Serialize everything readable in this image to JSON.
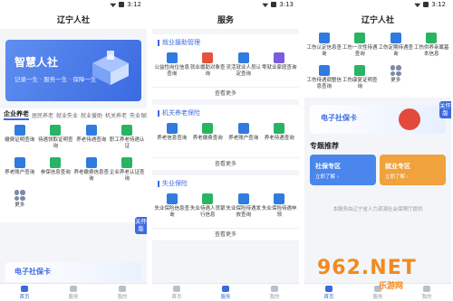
{
  "status": {
    "time1": "3:12",
    "time2": "3:13",
    "time3": "3:12"
  },
  "home": {
    "title": "辽宁人社",
    "banner": {
      "title": "智慧人社",
      "slogan": "记录一生 · 服务一生 · 保障一生"
    },
    "categories": [
      "企业养老",
      "居民养老",
      "就业失业",
      "就业援助",
      "机关养老",
      "失业保险",
      "工"
    ],
    "services": [
      {
        "label": "缴费证明查询",
        "color": "#2f7be0"
      },
      {
        "label": "待遇领取证明查询",
        "color": "#28b463"
      },
      {
        "label": "养老待遇查询",
        "color": "#2f7be0"
      },
      {
        "label": "职工养老待遇认证",
        "color": "#28b463"
      },
      {
        "label": "养老账户查询",
        "color": "#2f7be0"
      },
      {
        "label": "参保信息查询",
        "color": "#28b463"
      },
      {
        "label": "养老缴费信息查询",
        "color": "#2f7be0"
      },
      {
        "label": "企业养老认证查询",
        "color": "#28b463"
      }
    ],
    "more_label": "更多",
    "side_badge": "关怀版",
    "card_peek": "电子社保卡"
  },
  "services_page": {
    "title": "服务",
    "sections": [
      {
        "title": "就业援助管理",
        "items": [
          "公益性岗位信息查询",
          "就业援助对象查询",
          "灵活就业人员认定查询",
          "零就业家庭查询"
        ],
        "colors": [
          "#2f7be0",
          "#e2543b",
          "#2f7be0",
          "#7a5ce0"
        ],
        "see_more": "查看更多"
      },
      {
        "title": "机关养老保险",
        "items": [
          "养老信息查询",
          "养老缴费查询",
          "养老账户查询",
          "养老待遇查询"
        ],
        "colors": [
          "#2f7be0",
          "#28b463",
          "#2f7be0",
          "#28b463"
        ],
        "see_more": "查看更多"
      },
      {
        "title": "失业保险",
        "items": [
          "失业保险信息查询",
          "失业待遇人员银行信息",
          "失业保险待遇发放查询",
          "失业保险待遇申领"
        ],
        "colors": [
          "#2f7be0",
          "#28b463",
          "#2f7be0",
          "#2f7be0"
        ],
        "see_more": "查看更多"
      }
    ]
  },
  "home2": {
    "title": "辽宁人社",
    "services": [
      {
        "label": "工伤认定信息查询",
        "color": "#2f7be0"
      },
      {
        "label": "工伤一次性待遇查询",
        "color": "#28b463"
      },
      {
        "label": "工伤定期待遇查询",
        "color": "#2f7be0"
      },
      {
        "label": "工伤供养亲属基本信息",
        "color": "#28b463"
      },
      {
        "label": "工伤待遇调整信息查询",
        "color": "#2f7be0"
      },
      {
        "label": "工伤康复证明查询",
        "color": "#28b463"
      },
      {
        "label": "更多",
        "color": ""
      }
    ],
    "sicard_title": "电子社保卡",
    "side_badge": "关怀版",
    "topic_title": "专题推荐",
    "topics": [
      {
        "title": "社保专区",
        "sub": "立即了解 ›",
        "color": "#4a86ec"
      },
      {
        "title": "就业专区",
        "sub": "立即了解 ›",
        "color": "#f0a23c"
      }
    ],
    "footer": "本服务由辽宁省人力资源社会保障厅提供"
  },
  "tabs": [
    "首页",
    "服务",
    "我的"
  ],
  "watermark": {
    "brand": "962.NET",
    "sub": "乐游网"
  }
}
